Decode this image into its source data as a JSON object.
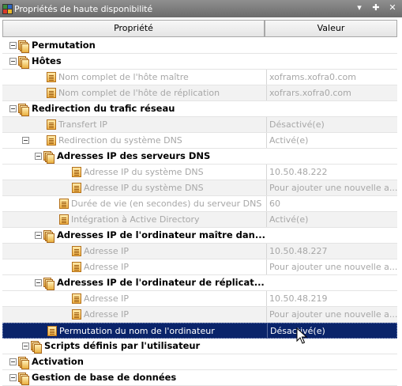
{
  "window": {
    "title": "Propriétés de haute disponibilité"
  },
  "columns": {
    "property": "Propriété",
    "value": "Valeur"
  },
  "rows": [
    {
      "indent": 0,
      "cat": true,
      "expander": true,
      "icon": "stack",
      "label": "Permutation",
      "value": ""
    },
    {
      "indent": 0,
      "cat": true,
      "expander": true,
      "icon": "stack",
      "label": "Hôtes",
      "value": ""
    },
    {
      "indent": 1,
      "cat": false,
      "expander": false,
      "icon": "doc",
      "label": "Nom complet de l'hôte maître",
      "value": "xoframs.xofra0.com"
    },
    {
      "indent": 1,
      "cat": false,
      "expander": false,
      "icon": "doc",
      "label": "Nom complet de l'hôte de réplication",
      "value": "xofrars.xofra0.com"
    },
    {
      "indent": 0,
      "cat": true,
      "expander": true,
      "icon": "stack",
      "label": "Redirection du trafic réseau",
      "value": ""
    },
    {
      "indent": 1,
      "cat": false,
      "expander": false,
      "icon": "doc",
      "label": "Transfert IP",
      "value": "Désactivé(e)"
    },
    {
      "indent": 1,
      "cat": false,
      "expander": true,
      "icon": "doc",
      "label": "Redirection du système DNS",
      "value": "Activé(e)"
    },
    {
      "indent": 2,
      "cat": true,
      "expander": true,
      "icon": "stack",
      "label": "Adresses IP des serveurs DNS",
      "value": ""
    },
    {
      "indent": 3,
      "cat": false,
      "expander": false,
      "icon": "doc",
      "label": "Adresse IP du système DNS",
      "value": "10.50.48.222"
    },
    {
      "indent": 3,
      "cat": false,
      "expander": false,
      "icon": "doc",
      "label": "Adresse IP du système DNS",
      "value": "Pour ajouter une nouvelle a..."
    },
    {
      "indent": 2,
      "cat": false,
      "expander": false,
      "icon": "doc",
      "label": "Durée de vie (en secondes) du serveur DNS",
      "value": "60"
    },
    {
      "indent": 2,
      "cat": false,
      "expander": false,
      "icon": "doc",
      "label": "Intégration à Active Directory",
      "value": "Activé(e)"
    },
    {
      "indent": 2,
      "cat": true,
      "expander": true,
      "icon": "stack",
      "label": "Adresses IP de l'ordinateur maître dan...",
      "value": ""
    },
    {
      "indent": 3,
      "cat": false,
      "expander": false,
      "icon": "doc",
      "label": "Adresse IP",
      "value": "10.50.48.227"
    },
    {
      "indent": 3,
      "cat": false,
      "expander": false,
      "icon": "doc",
      "label": "Adresse IP",
      "value": "Pour ajouter une nouvelle a..."
    },
    {
      "indent": 2,
      "cat": true,
      "expander": true,
      "icon": "stack",
      "label": "Adresses IP de l'ordinateur de réplicat...",
      "value": ""
    },
    {
      "indent": 3,
      "cat": false,
      "expander": false,
      "icon": "doc",
      "label": "Adresse IP",
      "value": "10.50.48.219"
    },
    {
      "indent": 3,
      "cat": false,
      "expander": false,
      "icon": "doc",
      "label": "Adresse IP",
      "value": "Pour ajouter une nouvelle a..."
    },
    {
      "indent": 1,
      "cat": false,
      "expander": false,
      "icon": "doc",
      "label": "Permutation du nom de l'ordinateur",
      "value": "Désactivé(e)",
      "selected": true
    },
    {
      "indent": 1,
      "cat": true,
      "expander": true,
      "icon": "stack",
      "label": "Scripts définis par l'utilisateur",
      "value": ""
    },
    {
      "indent": 0,
      "cat": true,
      "expander": true,
      "icon": "stack",
      "label": "Activation",
      "value": ""
    },
    {
      "indent": 0,
      "cat": true,
      "expander": true,
      "icon": "stack",
      "label": "Gestion de base de données",
      "value": ""
    }
  ]
}
